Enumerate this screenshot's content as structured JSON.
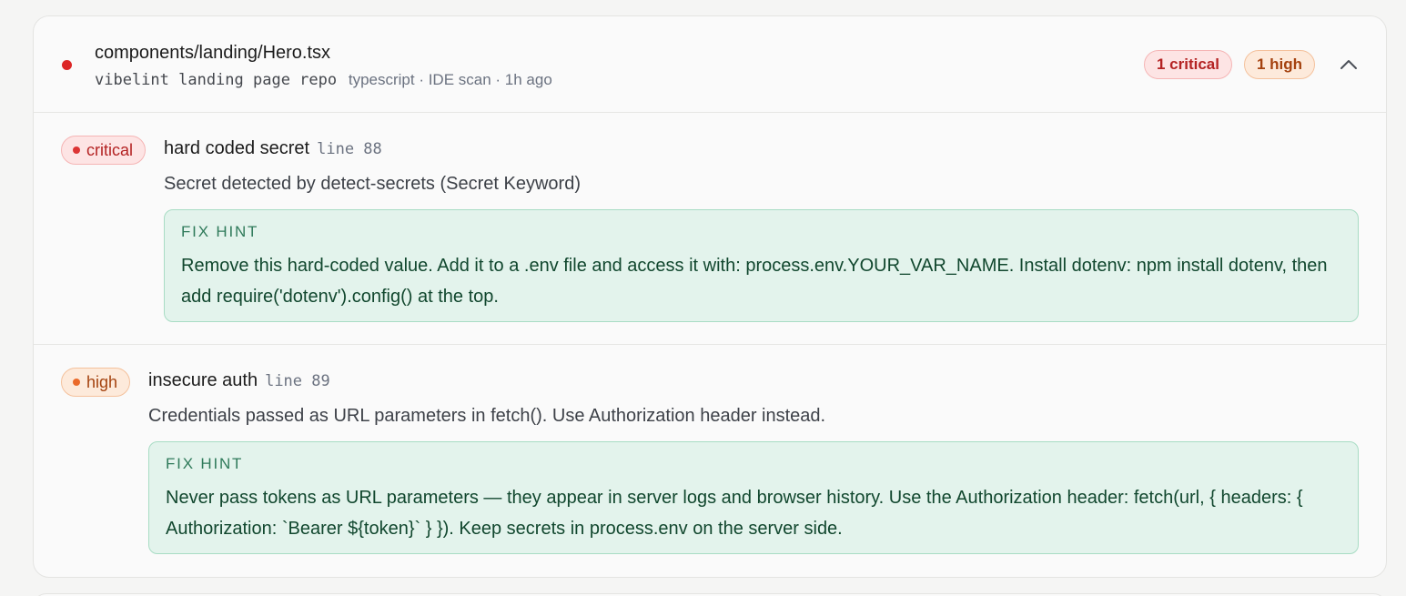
{
  "file": {
    "path": "components/landing/Hero.tsx",
    "repo": "vibelint landing page repo",
    "meta": "typescript · IDE scan · 1h ago",
    "counts": {
      "critical": "1 critical",
      "high": "1 high"
    },
    "collapse_icon": "chevron-up-icon"
  },
  "colors": {
    "critical": "#dc2626",
    "high": "#ea6a2a",
    "fix_bg": "#e3f3ec"
  },
  "findings": [
    {
      "severity": "critical",
      "title": "hard coded secret",
      "line": "line 88",
      "description": "Secret detected by detect-secrets (Secret Keyword)",
      "fix_label": "FIX HINT",
      "fix_text": "Remove this hard-coded value. Add it to a .env file and access it with: process.env.YOUR_VAR_NAME. Install dotenv: npm install dotenv, then add require('dotenv').config() at the top."
    },
    {
      "severity": "high",
      "title": "insecure auth",
      "line": "line 89",
      "description": "Credentials passed as URL parameters in fetch(). Use Authorization header instead.",
      "fix_label": "FIX HINT",
      "fix_text": "Never pass tokens as URL parameters — they appear in server logs and browser history. Use the Authorization header: fetch(url, { headers: { Authorization: `Bearer ${token}` } }). Keep secrets in process.env on the server side."
    }
  ]
}
